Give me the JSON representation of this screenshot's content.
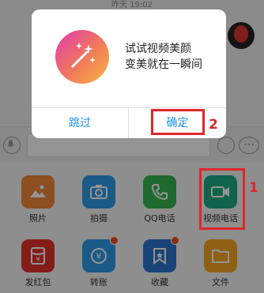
{
  "chat": {
    "timestamp": "昨天 19:02"
  },
  "dialog": {
    "icon": "magic-wand-icon",
    "message_line1": "试试视频美颜",
    "message_line2": "变美就在一瞬间",
    "cancel_label": "跳过",
    "confirm_label": "确定"
  },
  "input_bar": {
    "voice_icon": "microphone-icon",
    "emoji_icon": "emoji-icon",
    "more_icon": "more-icon"
  },
  "apps": [
    {
      "label": "照片",
      "icon": "photo-icon",
      "color": "#f0883a",
      "badge": false
    },
    {
      "label": "拍摄",
      "icon": "camera-icon",
      "color": "#2e9be8",
      "badge": false
    },
    {
      "label": "QQ电话",
      "icon": "phone-icon",
      "color": "#35b652",
      "badge": false
    },
    {
      "label": "视频电话",
      "icon": "video-call-icon",
      "color": "#1dab86",
      "badge": false
    },
    {
      "label": "发红包",
      "icon": "red-packet-icon",
      "color": "#e4322e",
      "badge": false
    },
    {
      "label": "转账",
      "icon": "transfer-icon",
      "color": "#2e9be8",
      "badge": true
    },
    {
      "label": "收藏",
      "icon": "favorite-icon",
      "color": "#2e74d0",
      "badge": true
    },
    {
      "label": "文件",
      "icon": "folder-icon",
      "color": "#f5a623",
      "badge": false
    }
  ],
  "annotations": {
    "step1": "1",
    "step2": "2",
    "highlight_color": "#e0262b"
  }
}
